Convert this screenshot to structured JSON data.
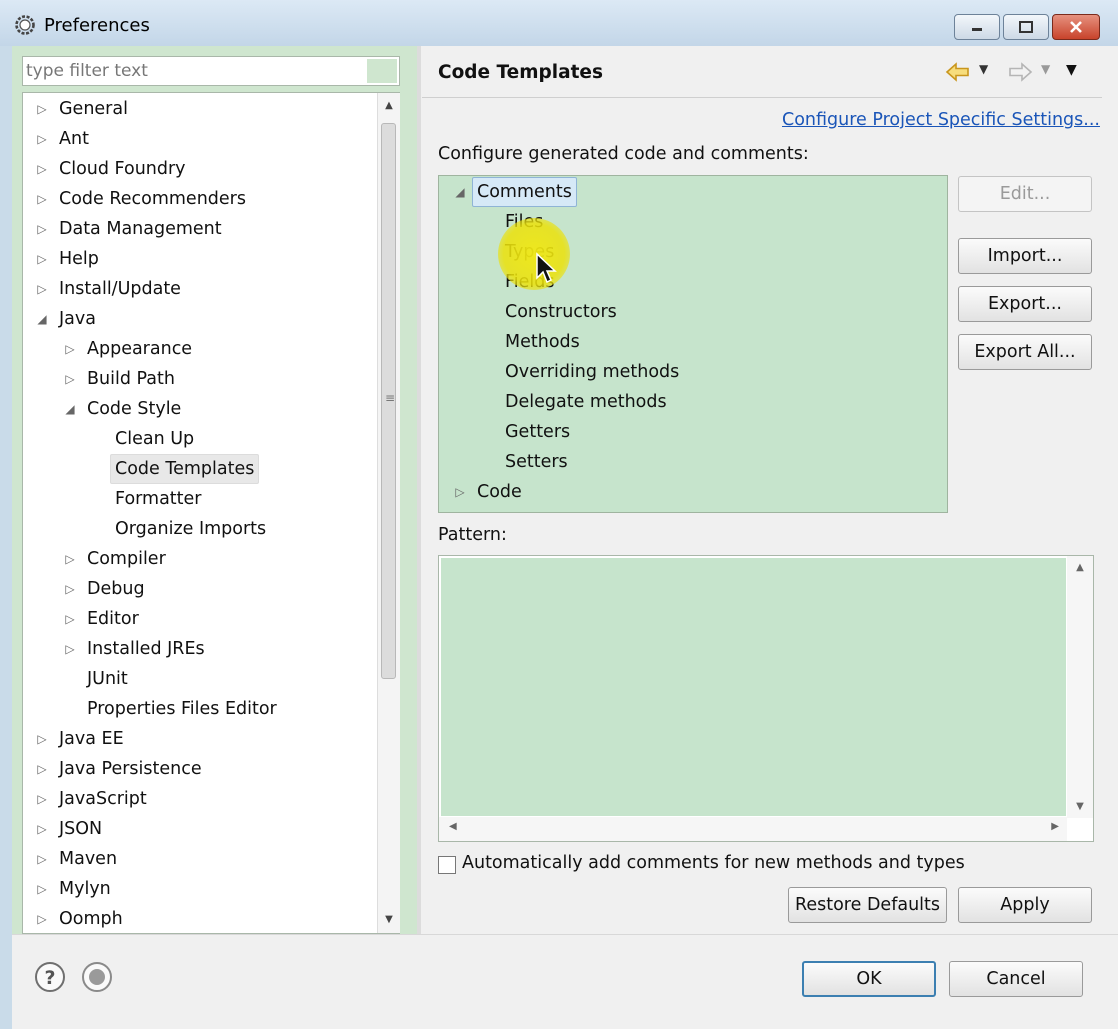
{
  "window": {
    "title": "Preferences",
    "controls": [
      "minimize",
      "maximize",
      "close"
    ]
  },
  "left_pane": {
    "filter_placeholder": "type filter text",
    "tree": [
      {
        "label": "General",
        "state": "collapsed"
      },
      {
        "label": "Ant",
        "state": "collapsed"
      },
      {
        "label": "Cloud Foundry",
        "state": "collapsed"
      },
      {
        "label": "Code Recommenders",
        "state": "collapsed"
      },
      {
        "label": "Data Management",
        "state": "collapsed"
      },
      {
        "label": "Help",
        "state": "collapsed"
      },
      {
        "label": "Install/Update",
        "state": "collapsed"
      },
      {
        "label": "Java",
        "state": "expanded"
      },
      {
        "label": "Appearance",
        "state": "collapsed"
      },
      {
        "label": "Build Path",
        "state": "collapsed"
      },
      {
        "label": "Code Style",
        "state": "expanded"
      },
      {
        "label": "Clean Up",
        "state": "leaf"
      },
      {
        "label": "Code Templates",
        "state": "leaf",
        "selected": true
      },
      {
        "label": "Formatter",
        "state": "leaf"
      },
      {
        "label": "Organize Imports",
        "state": "leaf"
      },
      {
        "label": "Compiler",
        "state": "collapsed"
      },
      {
        "label": "Debug",
        "state": "collapsed"
      },
      {
        "label": "Editor",
        "state": "collapsed"
      },
      {
        "label": "Installed JREs",
        "state": "collapsed"
      },
      {
        "label": "JUnit",
        "state": "leaf"
      },
      {
        "label": "Properties Files Editor",
        "state": "leaf"
      },
      {
        "label": "Java EE",
        "state": "collapsed"
      },
      {
        "label": "Java Persistence",
        "state": "collapsed"
      },
      {
        "label": "JavaScript",
        "state": "collapsed"
      },
      {
        "label": "JSON",
        "state": "collapsed"
      },
      {
        "label": "Maven",
        "state": "collapsed"
      },
      {
        "label": "Mylyn",
        "state": "collapsed"
      },
      {
        "label": "Oomph",
        "state": "collapsed"
      }
    ]
  },
  "right_pane": {
    "title": "Code Templates",
    "project_settings_link": "Configure Project Specific Settings...",
    "description": "Configure generated code and comments:",
    "templates": [
      {
        "label": "Comments",
        "state": "expanded",
        "selected": true
      },
      {
        "label": "Files",
        "state": "leaf"
      },
      {
        "label": "Types",
        "state": "leaf"
      },
      {
        "label": "Fields",
        "state": "leaf"
      },
      {
        "label": "Constructors",
        "state": "leaf"
      },
      {
        "label": "Methods",
        "state": "leaf"
      },
      {
        "label": "Overriding methods",
        "state": "leaf"
      },
      {
        "label": "Delegate methods",
        "state": "leaf"
      },
      {
        "label": "Getters",
        "state": "leaf"
      },
      {
        "label": "Setters",
        "state": "leaf"
      },
      {
        "label": "Code",
        "state": "collapsed"
      }
    ],
    "buttons": {
      "edit": "Edit...",
      "import": "Import...",
      "export": "Export...",
      "export_all": "Export All..."
    },
    "pattern_label": "Pattern:",
    "pattern_value": "",
    "auto_comments_label": "Automatically add comments for new methods and types",
    "auto_comments_checked": false,
    "restore_defaults": "Restore Defaults",
    "apply": "Apply"
  },
  "footer": {
    "ok": "OK",
    "cancel": "Cancel"
  },
  "colors": {
    "tree_background": "#c6e4cc",
    "link": "#1a55b8",
    "cursor_highlight": "#ece31a"
  }
}
